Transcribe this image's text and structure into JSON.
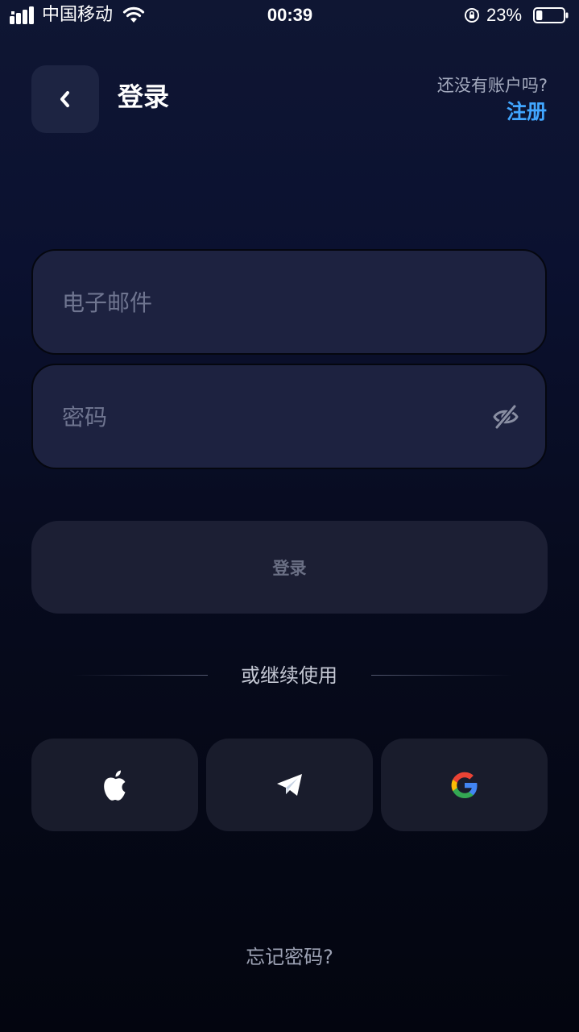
{
  "status_bar": {
    "carrier": "中国移动",
    "time": "00:39",
    "battery_percent": "23%",
    "battery_level": 0.23,
    "icons": [
      "signal-icon",
      "wifi-icon",
      "rotation-lock-icon",
      "battery-icon"
    ]
  },
  "header": {
    "back_icon": "chevron-left-icon",
    "title": "登录",
    "no_account_text": "还没有账户吗?",
    "register_label": "注册"
  },
  "form": {
    "email_placeholder": "电子邮件",
    "email_value": "",
    "password_placeholder": "密码",
    "password_value": "",
    "password_toggle_icon": "eye-off-icon",
    "login_label": "登录"
  },
  "divider": {
    "text": "或继续使用"
  },
  "social": [
    {
      "name": "apple",
      "icon": "apple-icon"
    },
    {
      "name": "telegram",
      "icon": "telegram-icon"
    },
    {
      "name": "google",
      "icon": "google-icon"
    }
  ],
  "footer": {
    "forgot_password": "忘记密码?"
  },
  "colors": {
    "accent": "#41a6ff",
    "background_top": "#0f1633",
    "background_bottom": "#03050f",
    "field_background": "#1d2240",
    "button_background": "#1c1f34"
  }
}
